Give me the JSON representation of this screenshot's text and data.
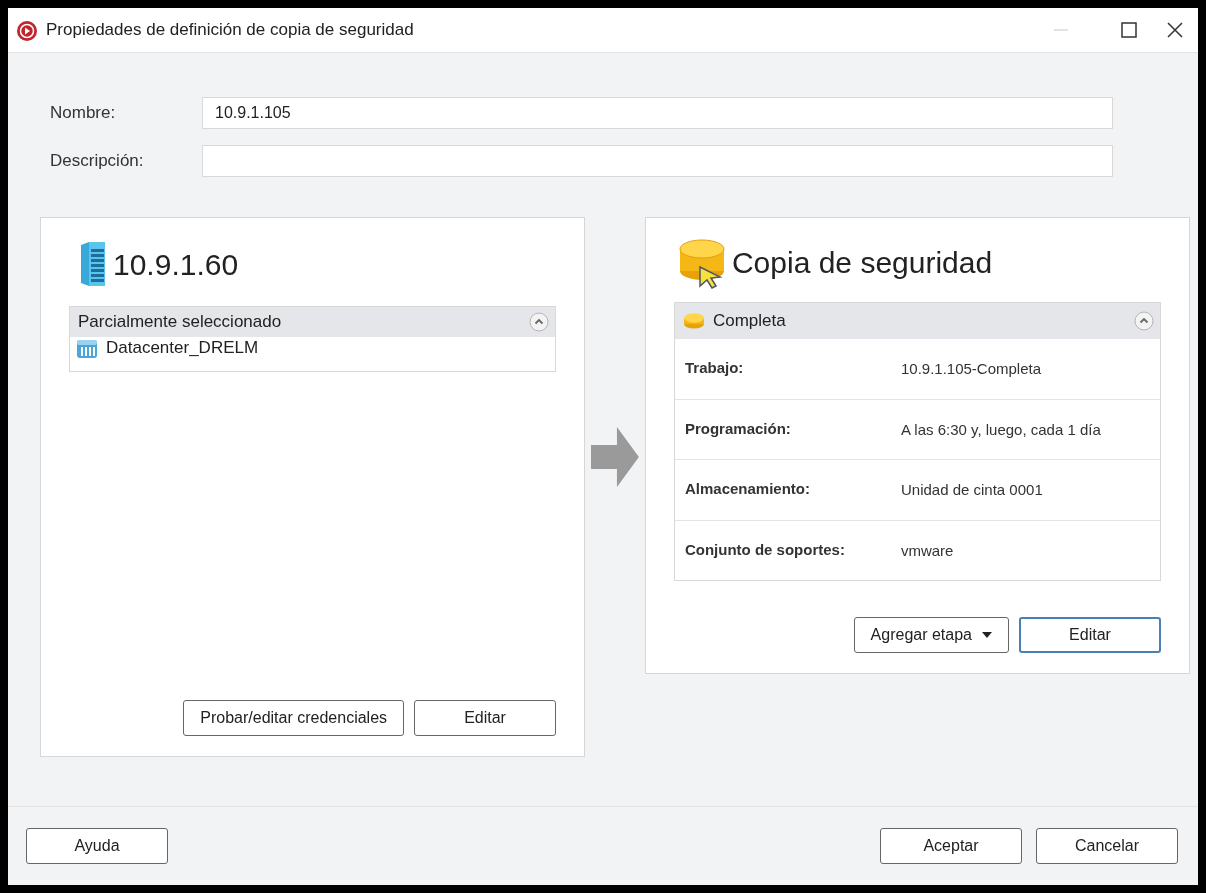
{
  "window": {
    "title": "Propiedades de definición de copia de seguridad",
    "minimize_disabled": true
  },
  "fields": [
    {
      "label": "Nombre:",
      "value": "10.9.1.105"
    },
    {
      "label": "Descripción:"
    }
  ],
  "source": {
    "title": "10.9.1.60",
    "section": {
      "title": "Parcialmente seleccionado",
      "expanded": true,
      "items": [
        "Datacenter_DRELM"
      ]
    },
    "buttons": [
      {
        "label": "Probar/editar credenciales",
        "default": false
      },
      {
        "label": "Editar",
        "default": false
      }
    ]
  },
  "destination": {
    "title": "Copia de seguridad",
    "section": {
      "title": "Completa",
      "expanded": true,
      "rows": [
        {
          "label": "Trabajo:",
          "value": "10.9.1.105-Completa"
        },
        {
          "label": "Programación:",
          "value": "A las 6:30 y, luego, cada 1 día"
        },
        {
          "label": "Almacenamiento:",
          "value": "Unidad de cinta 0001"
        },
        {
          "label": "Conjunto de soportes:",
          "value": "vmware"
        }
      ]
    },
    "buttons": [
      {
        "label": "Agregar etapa",
        "kind": "dropdown",
        "default": false
      },
      {
        "label": "Editar",
        "kind": "button",
        "default": true
      }
    ]
  },
  "footer": {
    "left_buttons": [
      {
        "label": "Ayuda",
        "default": false
      }
    ],
    "right_buttons": [
      {
        "label": "Aceptar",
        "default": false
      },
      {
        "label": "Cancelar",
        "default": false
      }
    ]
  }
}
